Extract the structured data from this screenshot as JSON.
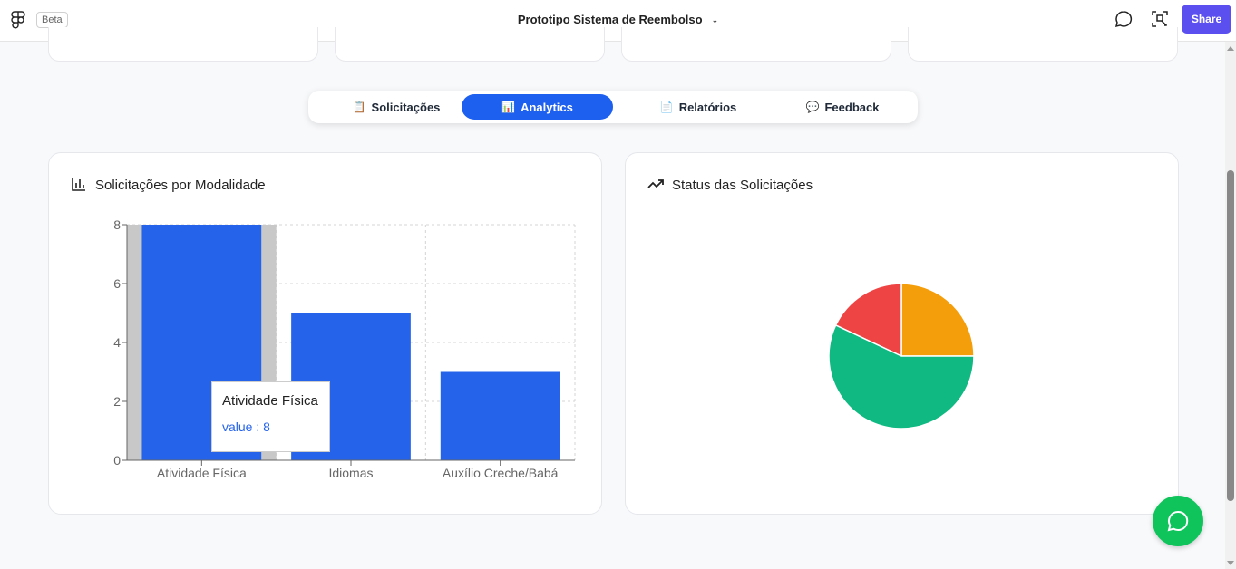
{
  "topbar": {
    "beta_label": "Beta",
    "doc_title": "Prototipo Sistema de Reembolso",
    "share_label": "Share",
    "chevron": "⌄"
  },
  "tabs": [
    {
      "label": "Solicitações",
      "icon": "clipboard-icon",
      "glyph": "📋",
      "active": false
    },
    {
      "label": "Analytics",
      "icon": "bar-chart-icon",
      "glyph": "📊",
      "active": true
    },
    {
      "label": "Relatórios",
      "icon": "document-icon",
      "glyph": "📄",
      "active": false
    },
    {
      "label": "Feedback",
      "icon": "speech-bubble-icon",
      "glyph": "💬",
      "active": false
    }
  ],
  "panels": {
    "bar": {
      "title": "Solicitações por Modalidade"
    },
    "pie": {
      "title": "Status das Solicitações"
    }
  },
  "tooltip": {
    "title": "Atividade Física",
    "value_label": "value : 8"
  },
  "colors": {
    "accent": "#1d5fef",
    "bar": "#2563eb",
    "share": "#5b4ff0",
    "chat": "#10c45c"
  },
  "chart_data": [
    {
      "type": "bar",
      "title": "Solicitações por Modalidade",
      "categories": [
        "Atividade Física",
        "Idiomas",
        "Auxílio Creche/Babá"
      ],
      "values": [
        8,
        5,
        3
      ],
      "ylim": [
        0,
        8
      ],
      "yticks": [
        0,
        2,
        4,
        6,
        8
      ],
      "grid": true,
      "color": "#2563eb"
    },
    {
      "type": "pie",
      "title": "Status das Solicitações",
      "slices": [
        {
          "value": 25,
          "color": "#f59e0b"
        },
        {
          "value": 18,
          "color": "#ef4444"
        },
        {
          "value": 57,
          "color": "#10b981"
        }
      ]
    }
  ]
}
